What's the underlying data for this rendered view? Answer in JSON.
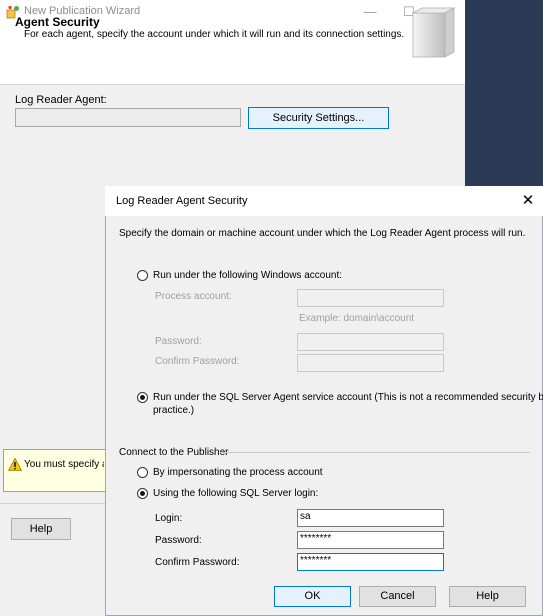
{
  "wizard": {
    "title": "New Publication Wizard",
    "caption_buttons": {
      "minimize": "—",
      "maximize": "☐",
      "close": "✕"
    },
    "heading": "Agent Security",
    "description": "For each agent, specify the account under which it will run and its connection settings.",
    "log_reader_label": "Log Reader Agent:",
    "log_reader_value": "",
    "security_settings_button": "Security Settings...",
    "warning_text": "You must specify a log reader agent security",
    "help_button": "Help"
  },
  "dialog": {
    "title": "Log Reader Agent Security",
    "close_glyph": "✕",
    "instructions": "Specify the domain or machine account under which the Log Reader Agent process will run.",
    "run_windows_account": {
      "label": "Run under the following Windows account:",
      "checked": false
    },
    "process_account_label": "Process account:",
    "process_account_value": "",
    "process_account_example": "Example: domain\\account",
    "password_label": "Password:",
    "password_value": "",
    "confirm_password_label": "Confirm Password:",
    "confirm_password_value": "",
    "run_sql_agent": {
      "label_line1": "Run under the SQL Server Agent service account (This is not a recommended security best",
      "label_line2": "practice.)",
      "checked": true
    },
    "connect_group_title": "Connect to the Publisher",
    "impersonate": {
      "label": "By impersonating the process account",
      "checked": false
    },
    "sql_login": {
      "label": "Using the following SQL Server login:",
      "checked": true
    },
    "login_label": "Login:",
    "login_value": "sa",
    "login_password_label": "Password:",
    "login_password_value": "********",
    "login_confirm_label": "Confirm Password:",
    "login_confirm_value": "********",
    "ok_button": "OK",
    "cancel_button": "Cancel",
    "help_button": "Help"
  },
  "colors": {
    "accent": "#0078d7",
    "warning_bg": "#ffffe1",
    "desktop": "#2b3a55"
  }
}
